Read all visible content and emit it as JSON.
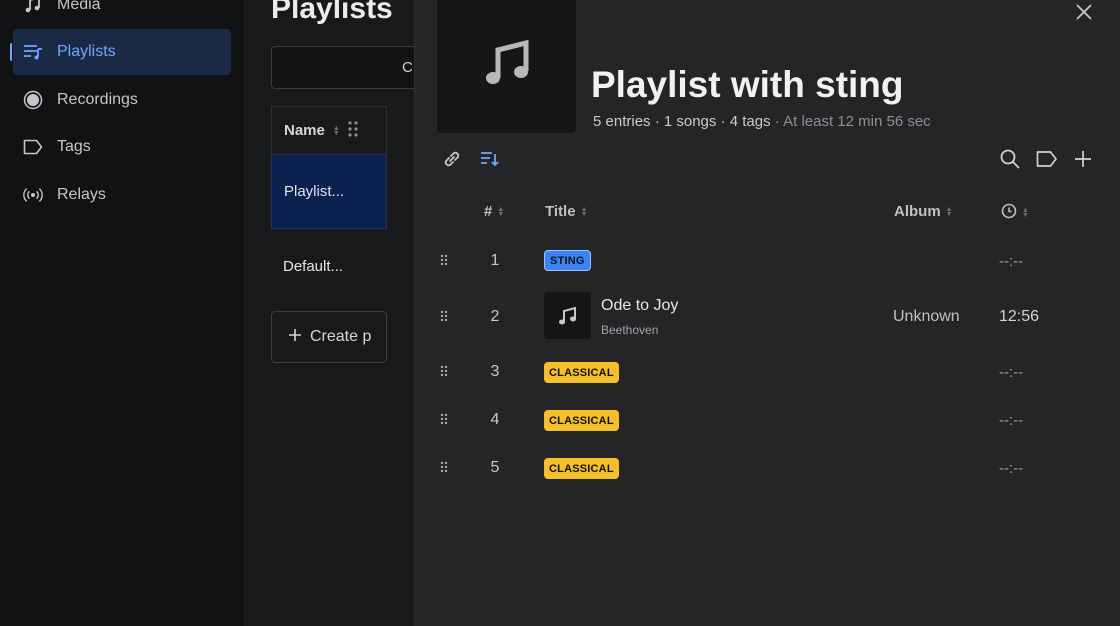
{
  "sidebar": {
    "items": [
      {
        "label": "Media",
        "icon": "music-note-icon"
      },
      {
        "label": "Playlists",
        "icon": "playlist-icon",
        "active": true
      },
      {
        "label": "Recordings",
        "icon": "record-icon"
      },
      {
        "label": "Tags",
        "icon": "tag-icon"
      },
      {
        "label": "Relays",
        "icon": "broadcast-icon"
      }
    ]
  },
  "middle": {
    "title": "Playlists",
    "search_glyph": "C",
    "list_header": "Name",
    "rows": [
      {
        "name": "Playlist...",
        "selected": true
      },
      {
        "name": "Default..."
      }
    ],
    "create_label": "Create p"
  },
  "detail": {
    "title": "Playlist with sting",
    "meta": "5 entries · 1 songs · 4 tags",
    "meta_extra": "· At least 12 min 56 sec",
    "columns": {
      "number": "#",
      "title": "Title",
      "album": "Album"
    },
    "entries": [
      {
        "number": "1",
        "type": "tag",
        "tag": "STING",
        "color": "#3b82f6",
        "duration": "--:--"
      },
      {
        "number": "2",
        "type": "song",
        "title": "Ode to Joy",
        "artist": "Beethoven",
        "album": "Unknown",
        "duration": "12:56"
      },
      {
        "number": "3",
        "type": "tag",
        "tag": "CLASSICAL",
        "color": "#f5c02a",
        "duration": "--:--"
      },
      {
        "number": "4",
        "type": "tag",
        "tag": "CLASSICAL",
        "color": "#f5c02a",
        "duration": "--:--"
      },
      {
        "number": "5",
        "type": "tag",
        "tag": "CLASSICAL",
        "color": "#f5c02a",
        "duration": "--:--"
      }
    ]
  },
  "colors": {
    "accent": "#6fa6ff",
    "selected_row": "#0b2150",
    "tag_blue": "#3b82f6",
    "tag_yellow": "#f5c02a"
  }
}
